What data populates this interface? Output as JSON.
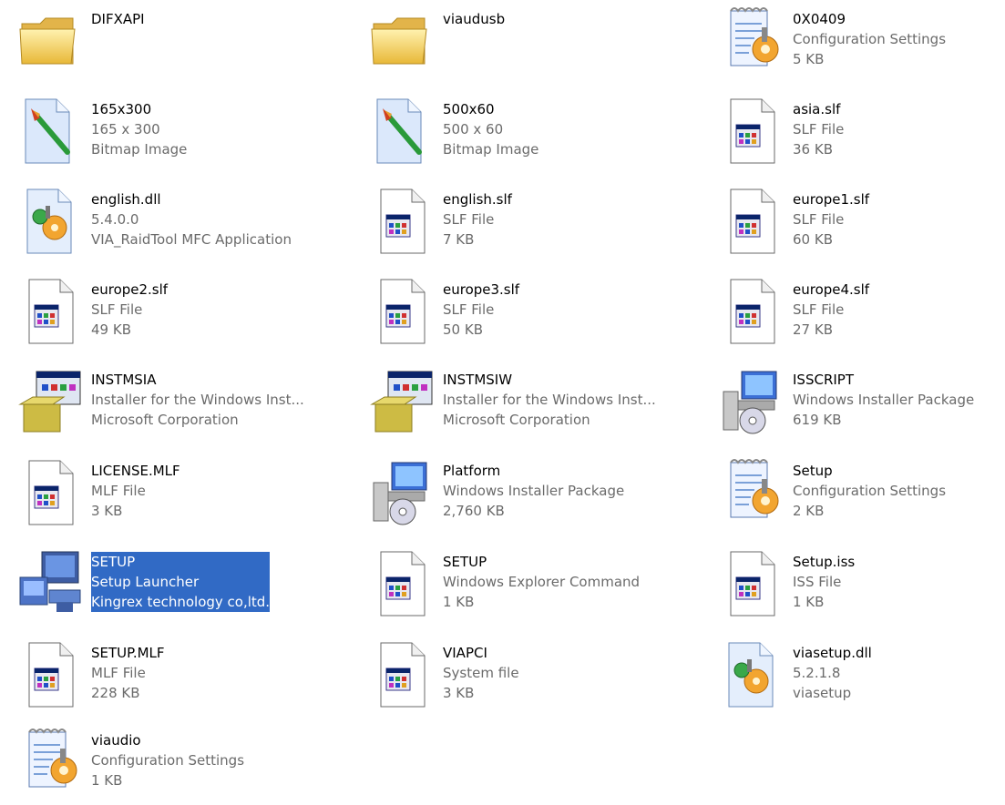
{
  "items": [
    {
      "name": "DIFXAPI",
      "l2": "",
      "l3": "",
      "icon": "folder-icon"
    },
    {
      "name": "viaudusb",
      "l2": "",
      "l3": "",
      "icon": "folder-icon"
    },
    {
      "name": "0X0409",
      "l2": "Configuration Settings",
      "l3": "5 KB",
      "icon": "config-settings-icon"
    },
    {
      "name": "165x300",
      "l2": "165 x 300",
      "l3": "Bitmap Image",
      "icon": "bitmap-paint-icon"
    },
    {
      "name": "500x60",
      "l2": "500 x 60",
      "l3": "Bitmap Image",
      "icon": "bitmap-paint-icon"
    },
    {
      "name": "asia.slf",
      "l2": "SLF File",
      "l3": "36 KB",
      "icon": "generic-file-icon"
    },
    {
      "name": "english.dll",
      "l2": "5.4.0.0",
      "l3": "VIA_RaidTool MFC Application",
      "icon": "dll-gear-icon"
    },
    {
      "name": "english.slf",
      "l2": "SLF File",
      "l3": "7 KB",
      "icon": "generic-file-icon"
    },
    {
      "name": "europe1.slf",
      "l2": "SLF File",
      "l3": "60 KB",
      "icon": "generic-file-icon"
    },
    {
      "name": "europe2.slf",
      "l2": "SLF File",
      "l3": "49 KB",
      "icon": "generic-file-icon"
    },
    {
      "name": "europe3.slf",
      "l2": "SLF File",
      "l3": "50 KB",
      "icon": "generic-file-icon"
    },
    {
      "name": "europe4.slf",
      "l2": "SLF File",
      "l3": "27 KB",
      "icon": "generic-file-icon"
    },
    {
      "name": "INSTMSIA",
      "l2": "Installer for the Windows Inst...",
      "l3": "Microsoft Corporation",
      "icon": "installer-box-icon"
    },
    {
      "name": "INSTMSIW",
      "l2": "Installer for the Windows Inst...",
      "l3": "Microsoft Corporation",
      "icon": "installer-box-icon"
    },
    {
      "name": "ISSCRIPT",
      "l2": "Windows Installer Package",
      "l3": "619 KB",
      "icon": "msi-package-icon"
    },
    {
      "name": "LICENSE.MLF",
      "l2": "MLF File",
      "l3": "3 KB",
      "icon": "generic-file-icon"
    },
    {
      "name": "Platform",
      "l2": "Windows Installer Package",
      "l3": "2,760 KB",
      "icon": "msi-package-icon"
    },
    {
      "name": "Setup",
      "l2": "Configuration Settings",
      "l3": "2 KB",
      "icon": "config-settings-icon"
    },
    {
      "name": "SETUP",
      "l2": "Setup Launcher",
      "l3": "Kingrex technology co,ltd.",
      "icon": "setup-computer-icon",
      "selected": true
    },
    {
      "name": "SETUP",
      "l2": "Windows Explorer Command",
      "l3": "1 KB",
      "icon": "generic-file-icon"
    },
    {
      "name": "Setup.iss",
      "l2": "ISS File",
      "l3": "1 KB",
      "icon": "generic-file-icon"
    },
    {
      "name": "SETUP.MLF",
      "l2": "MLF File",
      "l3": "228 KB",
      "icon": "generic-file-icon"
    },
    {
      "name": "VIAPCI",
      "l2": "System file",
      "l3": "3 KB",
      "icon": "generic-file-icon"
    },
    {
      "name": "viasetup.dll",
      "l2": "5.2.1.8",
      "l3": "viasetup",
      "icon": "dll-gear-icon"
    },
    {
      "name": "viaudio",
      "l2": "Configuration Settings",
      "l3": "1 KB",
      "icon": "config-settings-icon"
    }
  ],
  "colors": {
    "selection": "#316ac5",
    "subtext": "#6b6b6b"
  }
}
